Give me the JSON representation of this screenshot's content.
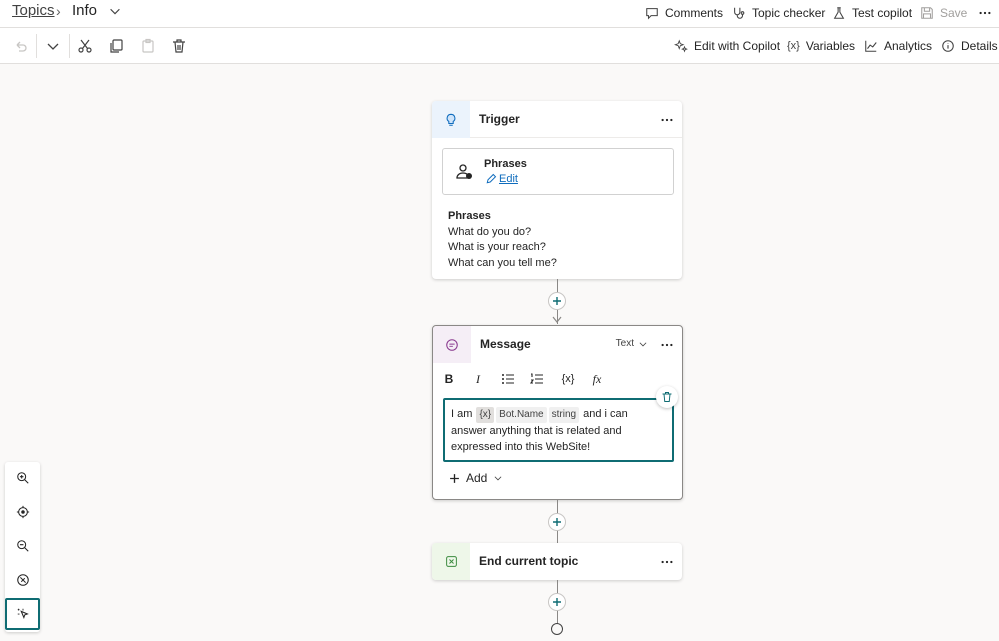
{
  "breadcrumb": {
    "root": "Topics",
    "current": "Info"
  },
  "top_actions": {
    "comments": "Comments",
    "topic_checker": "Topic checker",
    "test_copilot": "Test copilot",
    "save": "Save"
  },
  "toolbar": {
    "edit_with_copilot": "Edit with Copilot",
    "variables": "Variables",
    "analytics": "Analytics",
    "details": "Details"
  },
  "trigger_node": {
    "title": "Trigger",
    "card_title": "Phrases",
    "card_edit": "Edit",
    "phrases_header": "Phrases",
    "phrases": [
      "What do you do?",
      "What is your reach?",
      "What can you tell me?"
    ]
  },
  "message_node": {
    "title": "Message",
    "mode": "Text",
    "text_before": "I am",
    "variable_icon": "{x}",
    "variable_name": "Bot.Name",
    "variable_type": "string",
    "text_after": "and i can answer anything that is related and expressed into this WebSite!",
    "add_label": "Add"
  },
  "end_node": {
    "title": "End current topic"
  },
  "colors": {
    "accent": "#0f6c73",
    "link": "#0f6cbd",
    "trigger_bg": "#ebf3fc",
    "message_bg": "#f5eef6",
    "end_bg": "#eef7e9"
  },
  "icons": [
    "undo-icon",
    "chevron-down-icon",
    "cut-icon",
    "copy-icon",
    "paste-icon",
    "delete-icon",
    "comment-icon",
    "stethoscope-icon",
    "flask-icon",
    "save-icon",
    "more-icon",
    "sparkle-icon",
    "variable-icon",
    "chart-icon",
    "info-icon",
    "zoom-in-icon",
    "recenter-icon",
    "zoom-out-icon",
    "minimap-icon",
    "select-icon"
  ]
}
